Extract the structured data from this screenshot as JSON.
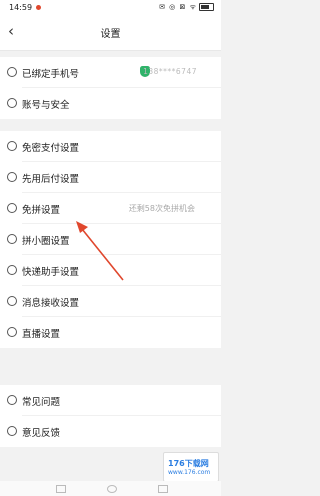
{
  "status_bar": {
    "time": "14:59",
    "icons": "✉ ◎ ⊠ ᯤ"
  },
  "header": {
    "title": "设置",
    "back_icon": "back-arrow-icon"
  },
  "groups": [
    {
      "items": [
        {
          "label": "已绑定手机号",
          "value": "138****6747"
        },
        {
          "label": "账号与安全"
        }
      ]
    },
    {
      "items": [
        {
          "label": "免密支付设置"
        },
        {
          "label": "先用后付设置"
        },
        {
          "label": "免拼设置",
          "value": "还剩58次免拼机会"
        },
        {
          "label": "拼小圈设置"
        },
        {
          "label": "快递助手设置"
        },
        {
          "label": "消息接收设置"
        },
        {
          "label": "直播设置"
        }
      ]
    },
    {
      "items": [
        {
          "label": "常见问题"
        },
        {
          "label": "意见反馈"
        }
      ]
    }
  ],
  "watermark": {
    "logo": "176下载网",
    "sub": "www.176.com"
  },
  "colors": {
    "accent": "#e0472d",
    "shield": "#30b36a"
  }
}
